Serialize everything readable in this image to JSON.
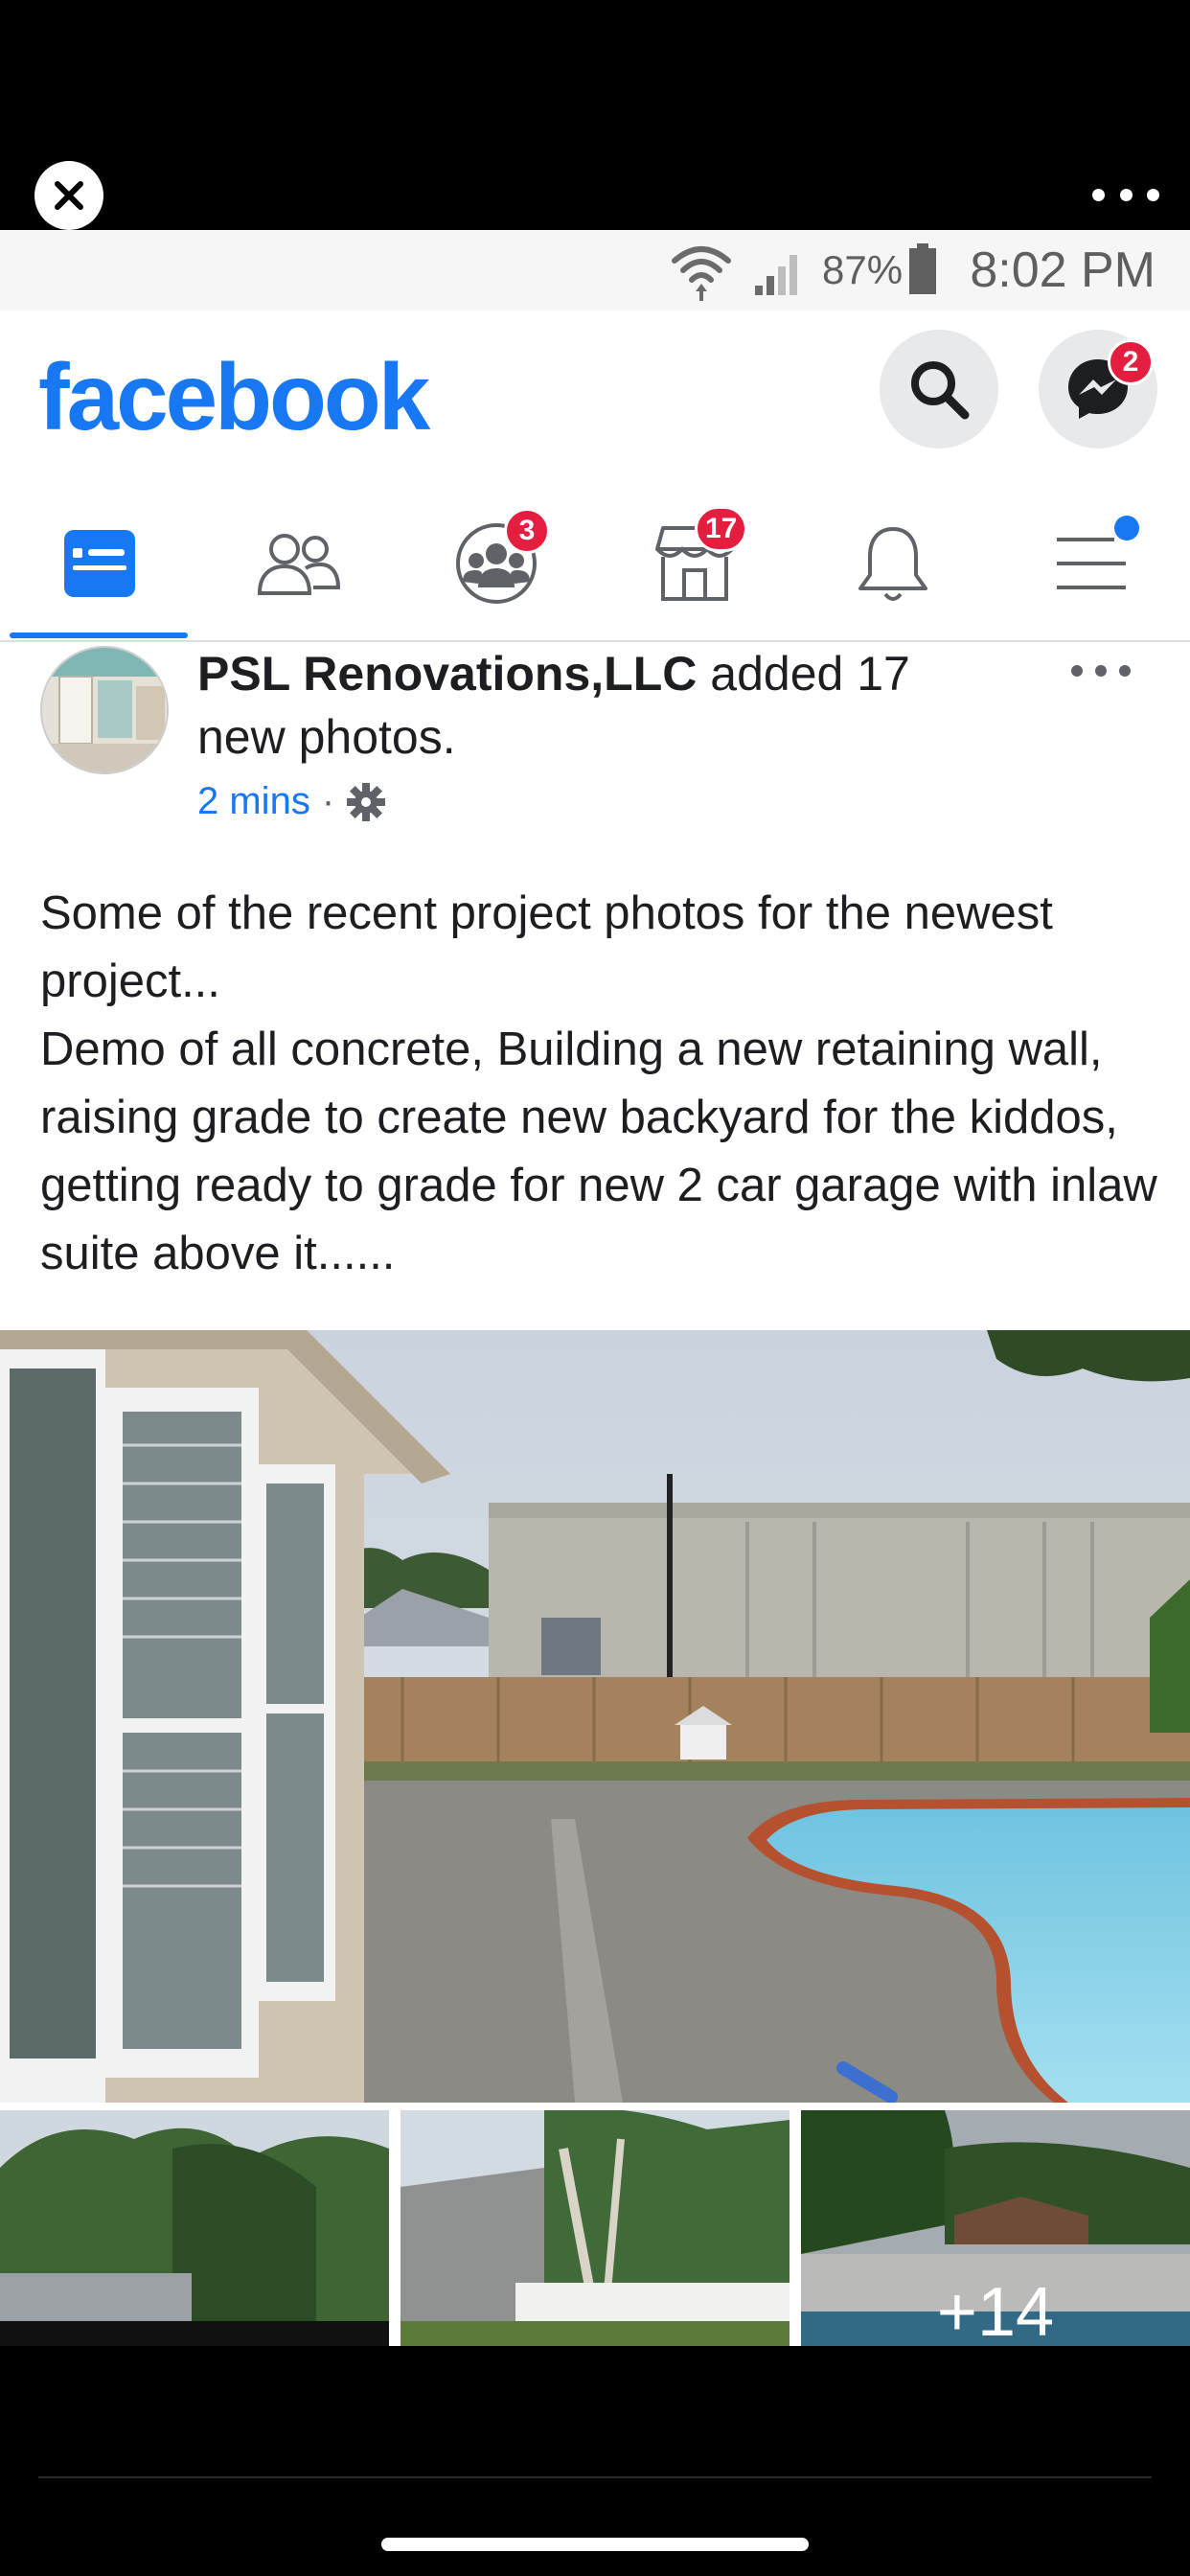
{
  "status_bar": {
    "time": "8:02 PM",
    "battery": "87%"
  },
  "header": {
    "logo": "facebook",
    "messenger_badge": "2"
  },
  "tabs": [
    {
      "name": "news-feed",
      "badge": ""
    },
    {
      "name": "friends",
      "badge": ""
    },
    {
      "name": "groups",
      "badge": "3"
    },
    {
      "name": "marketplace",
      "badge": "17"
    },
    {
      "name": "notifications",
      "badge": ""
    },
    {
      "name": "menu",
      "badge": ""
    }
  ],
  "post": {
    "author": "PSL Renovations,LLC",
    "action": " added 17 new photos.",
    "time": "2 mins",
    "separator": "·",
    "body_line1": "Some of the recent project photos for the newest project...",
    "body_line2": "Demo of all concrete, Building a new retaining wall, raising grade to create new backyard for the kiddos, getting ready to grade for new 2 car garage with inlaw suite above it......",
    "more_photos": "+14"
  },
  "colors": {
    "brand": "#1877f2",
    "badge": "#e41e3f"
  }
}
